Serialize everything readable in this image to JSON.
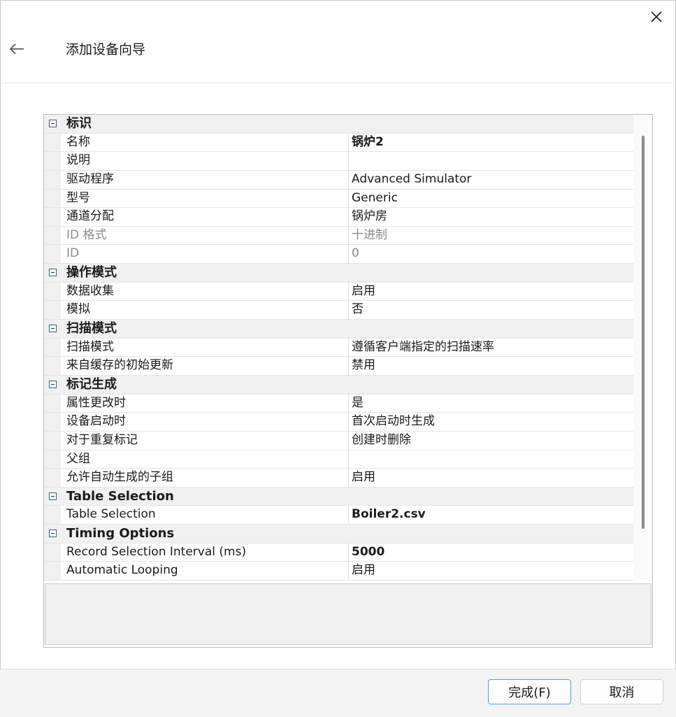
{
  "window": {
    "title": "添加设备向导"
  },
  "icons": {
    "close": "close-icon",
    "back": "back-arrow-icon",
    "collapse": "collapse-minus-icon"
  },
  "grid": {
    "categories": [
      {
        "label": "标识",
        "rows": [
          {
            "name": "名称",
            "value": "锅炉2",
            "bold": true,
            "disabled": false
          },
          {
            "name": "说明",
            "value": "",
            "bold": false,
            "disabled": false
          },
          {
            "name": "驱动程序",
            "value": "Advanced Simulator",
            "bold": false,
            "disabled": false
          },
          {
            "name": "型号",
            "value": "Generic",
            "bold": false,
            "disabled": false
          },
          {
            "name": "通道分配",
            "value": "锅炉房",
            "bold": false,
            "disabled": false
          },
          {
            "name": "ID 格式",
            "value": "十进制",
            "bold": false,
            "disabled": true
          },
          {
            "name": "ID",
            "value": "0",
            "bold": false,
            "disabled": true
          }
        ]
      },
      {
        "label": "操作模式",
        "rows": [
          {
            "name": "数据收集",
            "value": "启用",
            "bold": false,
            "disabled": false
          },
          {
            "name": "模拟",
            "value": "否",
            "bold": false,
            "disabled": false
          }
        ]
      },
      {
        "label": "扫描模式",
        "rows": [
          {
            "name": "扫描模式",
            "value": "遵循客户端指定的扫描速率",
            "bold": false,
            "disabled": false
          },
          {
            "name": "来自缓存的初始更新",
            "value": "禁用",
            "bold": false,
            "disabled": false
          }
        ]
      },
      {
        "label": "标记生成",
        "rows": [
          {
            "name": "属性更改时",
            "value": "是",
            "bold": false,
            "disabled": false
          },
          {
            "name": "设备启动时",
            "value": "首次启动时生成",
            "bold": false,
            "disabled": false
          },
          {
            "name": "对于重复标记",
            "value": "创建时删除",
            "bold": false,
            "disabled": false
          },
          {
            "name": "父组",
            "value": "",
            "bold": false,
            "disabled": false
          },
          {
            "name": "允许自动生成的子组",
            "value": "启用",
            "bold": false,
            "disabled": false
          }
        ]
      },
      {
        "label": "Table Selection",
        "rows": [
          {
            "name": "Table Selection",
            "value": "Boiler2.csv",
            "bold": true,
            "disabled": false
          }
        ]
      },
      {
        "label": "Timing Options",
        "rows": [
          {
            "name": "Record Selection Interval (ms)",
            "value": "5000",
            "bold": true,
            "disabled": false
          },
          {
            "name": "Automatic Looping",
            "value": "启用",
            "bold": false,
            "disabled": false
          }
        ]
      }
    ]
  },
  "buttons": {
    "finish": "完成(F)",
    "cancel": "取消"
  }
}
